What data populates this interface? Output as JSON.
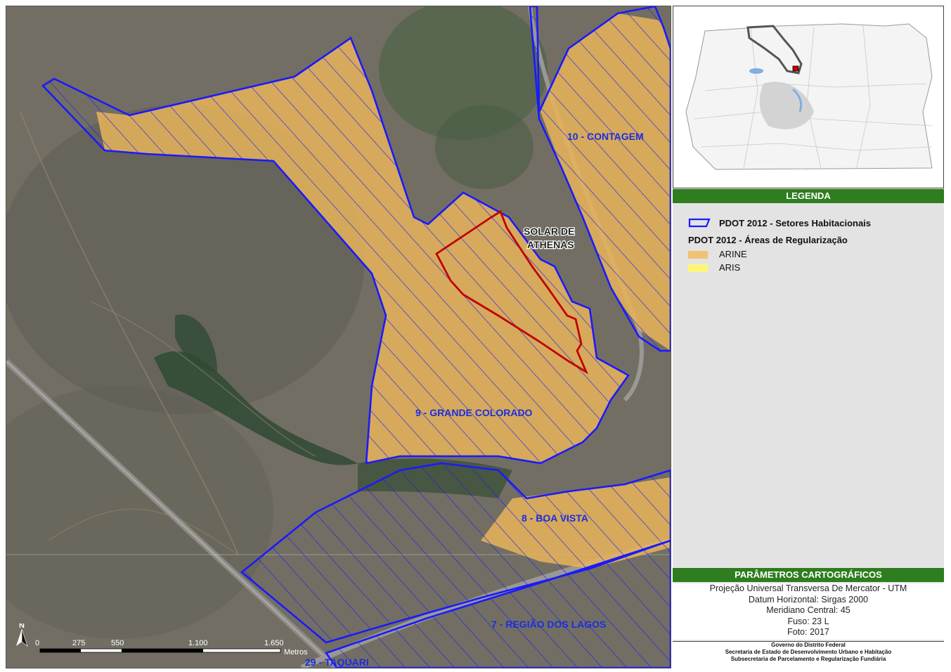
{
  "map": {
    "zones": [
      {
        "label": "10 - CONTAGEM"
      },
      {
        "label": "9 - GRANDE COLORADO"
      },
      {
        "label": "8 - BOA VISTA"
      },
      {
        "label": "7 - REGIÃO DOS LAGOS"
      },
      {
        "label": "29 - TAQUARI"
      }
    ],
    "place": {
      "line1": "SOLAR DE",
      "line2": "ATHENAS"
    },
    "north_label": "N",
    "scale": {
      "ticks": [
        "0",
        "275",
        "550",
        "1.100",
        "1.650"
      ],
      "unit": "Metros"
    },
    "colors": {
      "sector_outline": "#1a1aff",
      "regularization_area": "#e8b45a",
      "focus_outline": "#c00000",
      "satellite_base": "#6a6a5a"
    }
  },
  "legend": {
    "title": "LEGENDA",
    "sector_item": "PDOT 2012 - Setores Habitacionais",
    "areas_heading": "PDOT 2012 - Áreas de Regularização",
    "items": [
      {
        "label": "ARINE",
        "color": "#f0c274"
      },
      {
        "label": "ARIS",
        "color": "#fff57a"
      }
    ]
  },
  "params": {
    "title": "PARÂMETROS CARTOGRÁFICOS",
    "lines": [
      "Projeção Universal Transversa De Mercator - UTM",
      "Datum Horizontal: Sirgas 2000",
      "Meridiano Central: 45",
      "Fuso: 23 L",
      "Foto: 2017"
    ]
  },
  "credits": [
    "Governo do Distrito Federal",
    "Secretaria de Estado de Desenvolvimento Urbano e Habitação",
    "Subsecretaria de Parcelamento e Regularização Fundiária"
  ]
}
